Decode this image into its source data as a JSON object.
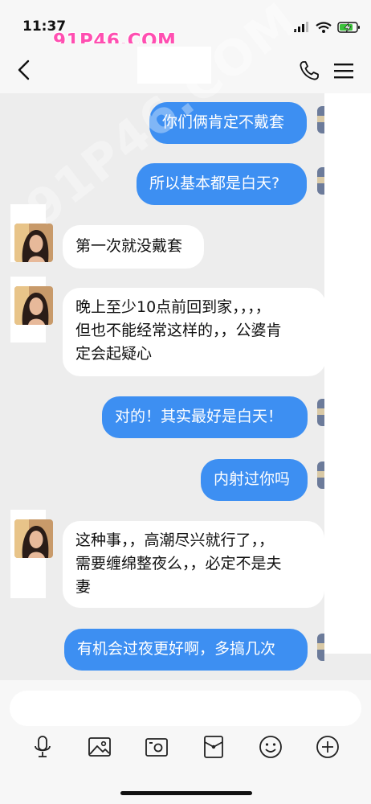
{
  "status_bar": {
    "time": "11:37",
    "watermark": "91P46.COM"
  },
  "watermark_diagonal": "91P46.COM",
  "nav": {
    "back_icon": "chevron-left-icon",
    "call_icon": "phone-icon",
    "menu_icon": "hamburger-menu-icon"
  },
  "messages": [
    {
      "sender": "me",
      "text": "你们俩肯定不戴套"
    },
    {
      "sender": "me",
      "text": "所以基本都是白天?"
    },
    {
      "sender": "other",
      "text": "第一次就没戴套"
    },
    {
      "sender": "other",
      "lines": [
        "晚上至少10点前回到家，，，，",
        "但也不能经常这样的，，公婆肯",
        "定会起疑心"
      ]
    },
    {
      "sender": "me",
      "text": "对的！其实最好是白天！"
    },
    {
      "sender": "me",
      "text": "内射过你吗"
    },
    {
      "sender": "other",
      "lines": [
        "这种事，，高潮尽兴就行了，，",
        "需要缠绵整夜么，，必定不是夫",
        "妻"
      ]
    },
    {
      "sender": "me",
      "text": "有机会过夜更好啊，多搞几次"
    }
  ],
  "input": {
    "placeholder": ""
  },
  "toolbar": [
    "microphone-icon",
    "image-icon",
    "camera-icon",
    "red-packet-icon",
    "emoji-icon",
    "plus-circle-icon"
  ],
  "colors": {
    "my_bubble": "#3d8ff2",
    "their_bubble": "#ffffff",
    "chat_background": "#ededed",
    "watermark": "#ff4fb1"
  }
}
